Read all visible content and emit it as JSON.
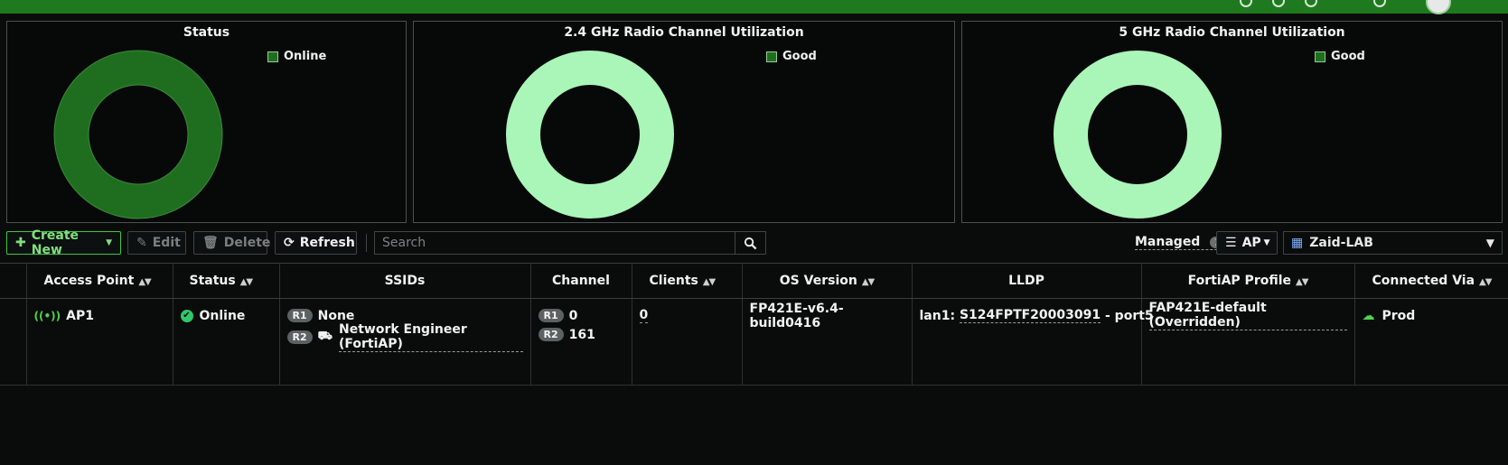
{
  "colors": {
    "accent": "#1f7a1f",
    "status_online": "#1f6e1f",
    "util_good": "#aaf5b8",
    "background": "#0a0c0c"
  },
  "widgets": {
    "status": {
      "title": "Status",
      "legend": "Online",
      "legend_color": "#1f6e1f"
    },
    "radio24": {
      "title": "2.4 GHz Radio Channel Utilization",
      "legend": "Good",
      "legend_color": "#aaf5b8"
    },
    "radio5": {
      "title": "5 GHz Radio Channel Utilization",
      "legend": "Good",
      "legend_color": "#aaf5b8"
    }
  },
  "chart_data": [
    {
      "type": "pie",
      "title": "Status",
      "categories": [
        "Online"
      ],
      "values": [
        1
      ]
    },
    {
      "type": "pie",
      "title": "2.4 GHz Radio Channel Utilization",
      "categories": [
        "Good"
      ],
      "values": [
        1
      ]
    },
    {
      "type": "pie",
      "title": "5 GHz Radio Channel Utilization",
      "categories": [
        "Good"
      ],
      "values": [
        1
      ]
    }
  ],
  "toolbar": {
    "create_label": "Create New",
    "edit_label": "Edit",
    "delete_label": "Delete",
    "refresh_label": "Refresh",
    "search_placeholder": "Search",
    "managed_label": "Managed",
    "managed_count": "1",
    "ap_label": "AP",
    "vdom_label": "Zaid-LAB"
  },
  "table": {
    "headers": {
      "access_point": "Access Point",
      "status": "Status",
      "ssids": "SSIDs",
      "channel": "Channel",
      "clients": "Clients",
      "os_version": "OS Version",
      "lldp": "LLDP",
      "fortiap_profile": "FortiAP Profile",
      "connected_via": "Connected Via"
    },
    "rows": [
      {
        "access_point": "AP1",
        "status": "Online",
        "ssid_r1_tag": "R1",
        "ssid_r1": "None",
        "ssid_r2_tag": "R2",
        "ssid_r2": "Network Engineer (FortiAP)",
        "channel_r1_tag": "R1",
        "channel_r1": "0",
        "channel_r2_tag": "R2",
        "channel_r2": "161",
        "clients": "0",
        "os_version": "FP421E-v6.4-build0416",
        "lldp_prefix": "lan1: ",
        "lldp_device": "S124FPTF20003091",
        "lldp_suffix": " - port5",
        "fortiap_profile": "FAP421E-default (Overridden)",
        "connected_via": "Prod"
      }
    ]
  }
}
